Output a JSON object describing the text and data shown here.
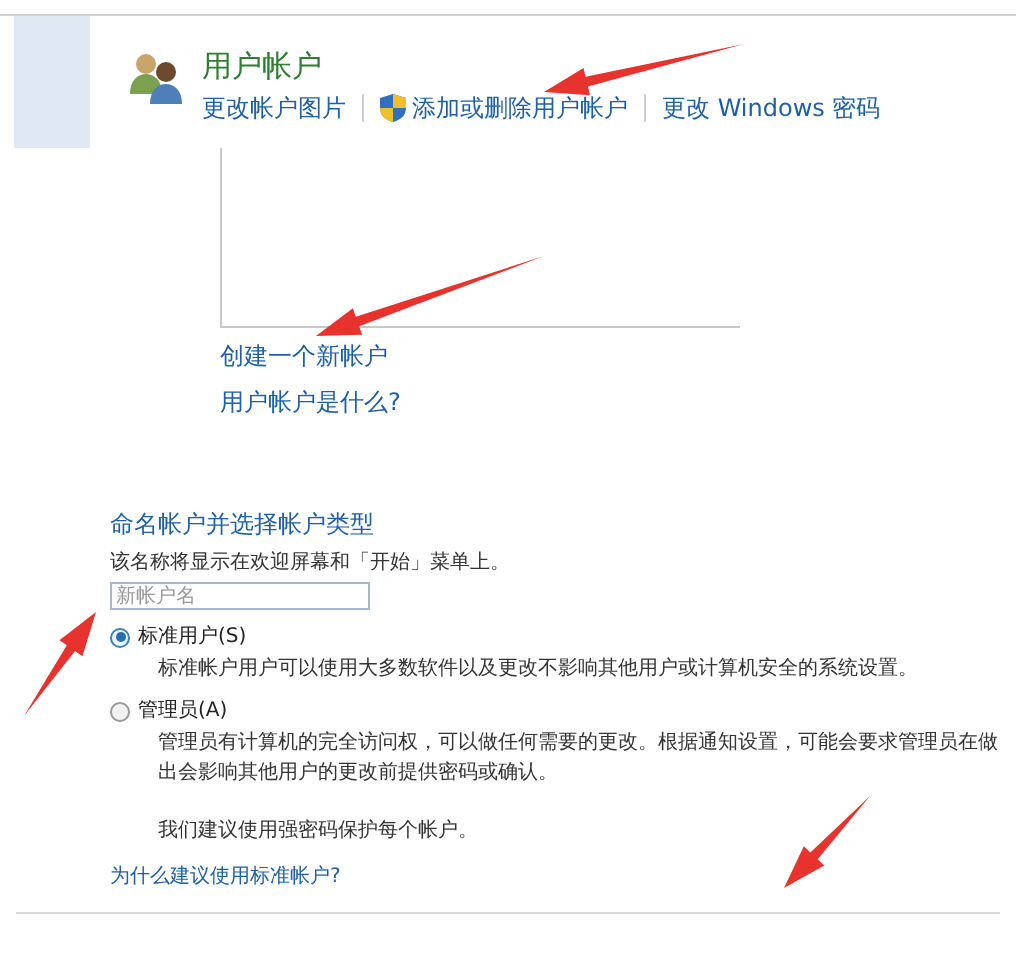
{
  "header": {
    "title": "用户帐户",
    "links": [
      {
        "label": "更改帐户图片",
        "shield": false
      },
      {
        "label": "添加或删除用户帐户",
        "shield": true
      },
      {
        "label": "更改 Windows 密码",
        "shield": false
      }
    ]
  },
  "account_links": [
    "创建一个新帐户",
    "用户帐户是什么?"
  ],
  "form": {
    "title": "命名帐户并选择帐户类型",
    "hint": "该名称将显示在欢迎屏幕和「开始」菜单上。",
    "name_field": {
      "placeholder": "新帐户名"
    },
    "types": [
      {
        "label": "标准用户(S)",
        "selected": true,
        "description": "标准帐户用户可以使用大多数软件以及更改不影响其他用户或计算机安全的系统设置。"
      },
      {
        "label": "管理员(A)",
        "selected": false,
        "description": "管理员有计算机的完全访问权，可以做任何需要的更改。根据通知设置，可能会要求管理员在做出会影响其他用户的更改前提供密码或确认。"
      }
    ],
    "note": "我们建议使用强密码保护每个帐户。",
    "help_link": "为什么建议使用标准帐户?"
  }
}
